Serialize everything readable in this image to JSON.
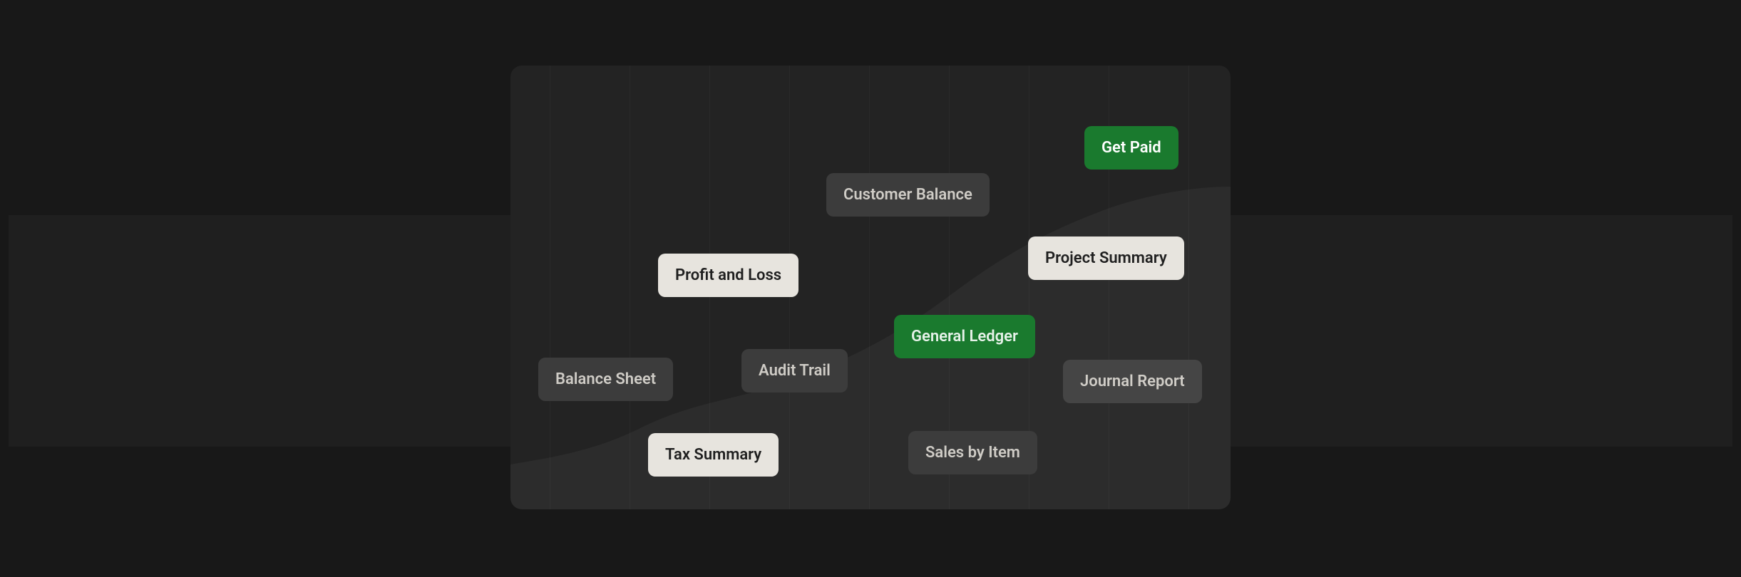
{
  "pills": {
    "get_paid": "Get Paid",
    "customer_balance": "Customer Balance",
    "project_summary": "Project Summary",
    "profit_and_loss": "Profit and Loss",
    "general_ledger": "General Ledger",
    "balance_sheet": "Balance Sheet",
    "audit_trail": "Audit Trail",
    "journal_report": "Journal Report",
    "tax_summary": "Tax Summary",
    "sales_by_item": "Sales by Item"
  }
}
